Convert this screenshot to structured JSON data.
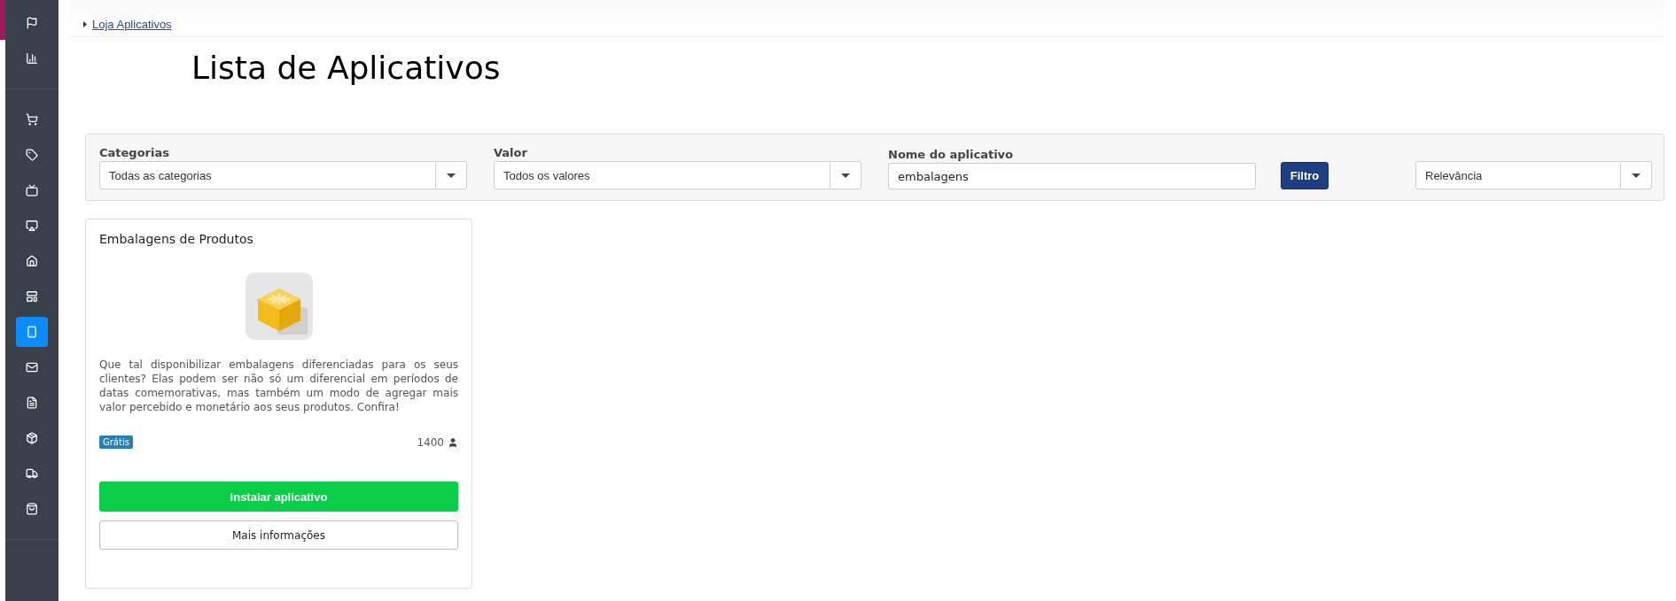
{
  "sidebar": {
    "items": [
      {
        "selected": false
      },
      {
        "selected": false
      },
      {
        "selected": false
      },
      {
        "selected": false
      },
      {
        "selected": false
      },
      {
        "selected": false
      },
      {
        "selected": false
      },
      {
        "selected": false
      },
      {
        "selected": true
      },
      {
        "selected": false
      },
      {
        "selected": false
      },
      {
        "selected": false
      },
      {
        "selected": false
      },
      {
        "selected": false
      }
    ]
  },
  "breadcrumb": {
    "label": "Loja Aplicativos"
  },
  "title": "Lista de Aplicativos",
  "filters": {
    "category": {
      "label": "Categorias",
      "value": "Todas as categorias"
    },
    "price": {
      "label": "Valor",
      "value": "Todos os valores"
    },
    "name": {
      "label": "Nome do aplicativo",
      "value": "embalagens"
    },
    "filter_button": "Filtro",
    "sort": {
      "value": "Relevância"
    }
  },
  "apps": [
    {
      "name": "Embalagens de Produtos",
      "description": "Que tal disponibilizar embalagens diferenciadas para os seus clientes? Elas podem ser não só um diferencial em períodos de datas comemorativas, mas também um modo de agregar mais valor percebido e monetário aos seus produtos. Confira!",
      "price_tag": "Grátis",
      "installs": "1400",
      "install_button": "Instalar aplicativo",
      "info_button": "Mais informações"
    }
  ]
}
